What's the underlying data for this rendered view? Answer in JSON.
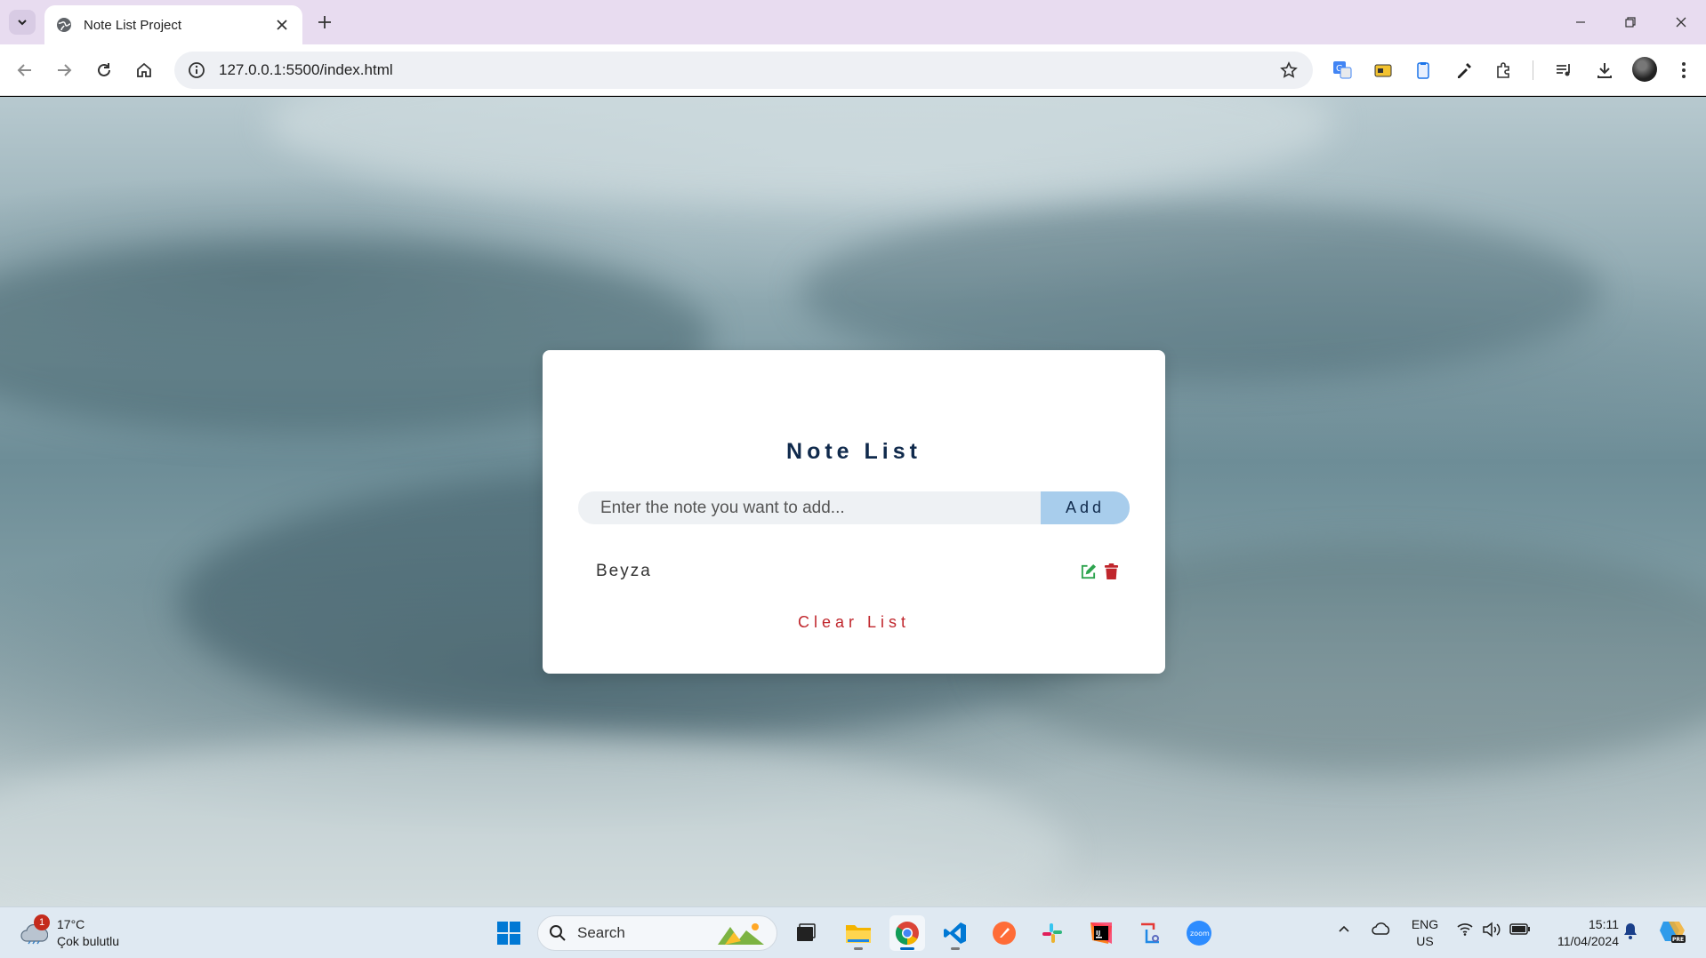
{
  "browser": {
    "tab_title": "Note List Project",
    "url": "127.0.0.1:5500/index.html"
  },
  "app": {
    "title": "Note List",
    "input_placeholder": "Enter the note you want to add...",
    "add_label": "Add",
    "notes": [
      {
        "text": "Beyza"
      }
    ],
    "clear_label": "Clear List",
    "colors": {
      "title": "#102a4c",
      "add_button": "#a8cdec",
      "clear": "#c0262c",
      "edit_icon": "#2ea44f",
      "delete_icon": "#c0262c"
    }
  },
  "taskbar": {
    "weather": {
      "temperature": "17°C",
      "description": "Çok bulutlu",
      "badge": "1"
    },
    "search_label": "Search",
    "language": {
      "line1": "ENG",
      "line2": "US"
    },
    "clock": {
      "time": "15:11",
      "date": "11/04/2024"
    },
    "apps": [
      "widgets-app",
      "task-view",
      "file-explorer",
      "chrome",
      "vscode",
      "postman",
      "slack",
      "intellij",
      "snipping-tool",
      "zoom"
    ]
  }
}
